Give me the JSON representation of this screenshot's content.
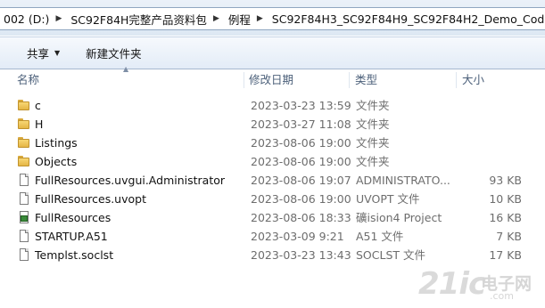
{
  "address": {
    "crumbs": [
      {
        "label": "002 (D:)"
      },
      {
        "label": "SC92F84H完整产品资料包"
      },
      {
        "label": "例程"
      },
      {
        "label": "SC92F84H3_SC92F84H9_SC92F84H2_Demo_Code"
      }
    ]
  },
  "toolbar": {
    "share_label": "共享",
    "new_folder_label": "新建文件夹"
  },
  "columns": {
    "name": "名称",
    "date": "修改日期",
    "type": "类型",
    "size": "大小"
  },
  "files": [
    {
      "name": "c",
      "date": "2023-03-23 13:59",
      "type": "文件夹",
      "size": "",
      "icon": "folder-icon"
    },
    {
      "name": "H",
      "date": "2023-03-27 11:08",
      "type": "文件夹",
      "size": "",
      "icon": "folder-icon"
    },
    {
      "name": "Listings",
      "date": "2023-08-06 19:00",
      "type": "文件夹",
      "size": "",
      "icon": "folder-icon"
    },
    {
      "name": "Objects",
      "date": "2023-08-06 19:00",
      "type": "文件夹",
      "size": "",
      "icon": "folder-icon"
    },
    {
      "name": "FullResources.uvgui.Administrator",
      "date": "2023-08-06 19:07",
      "type": "ADMINISTRATO...",
      "size": "93 KB",
      "icon": "file-icon"
    },
    {
      "name": "FullResources.uvopt",
      "date": "2023-08-06 19:00",
      "type": "UVOPT 文件",
      "size": "10 KB",
      "icon": "file-icon"
    },
    {
      "name": "FullResources",
      "date": "2023-08-06 18:33",
      "type": "礦ision4 Project",
      "size": "16 KB",
      "icon": "uvision-project-icon"
    },
    {
      "name": "STARTUP.A51",
      "date": "2023-03-09 9:21",
      "type": "A51 文件",
      "size": "7 KB",
      "icon": "file-icon"
    },
    {
      "name": "Templst.soclst",
      "date": "2023-03-23 13:43",
      "type": "SOCLST 文件",
      "size": "17 KB",
      "icon": "file-icon"
    }
  ],
  "watermark": {
    "text": "21ic",
    "cn": "电子网",
    "com": ".com"
  }
}
